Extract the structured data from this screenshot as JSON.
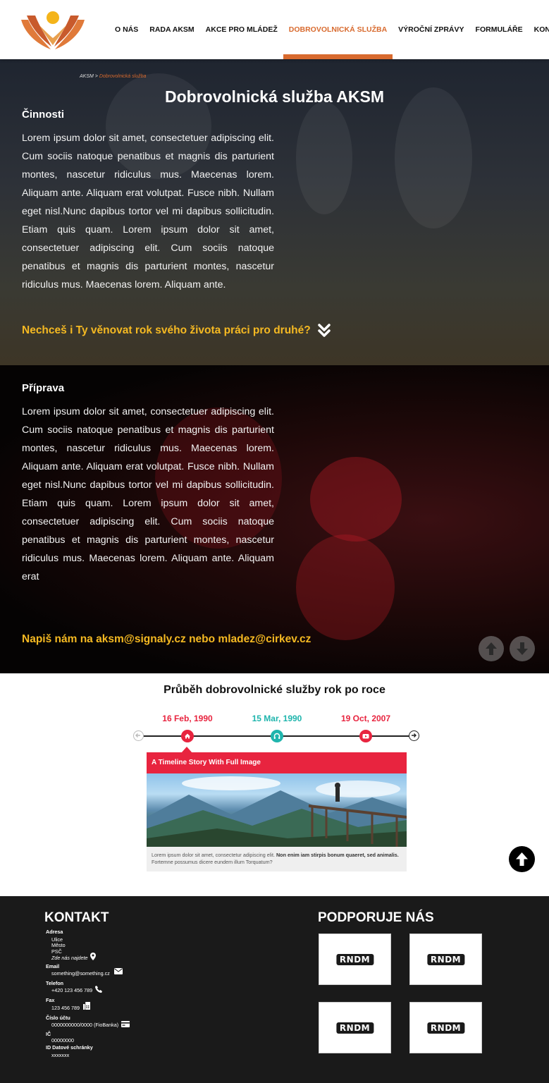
{
  "nav": {
    "items": [
      {
        "label": "O NÁS"
      },
      {
        "label": "RADA AKSM"
      },
      {
        "label": "AKCE PRO MLÁDEŽ"
      },
      {
        "label": "DOBROVOLNICKÁ SLUŽBA",
        "active": true
      },
      {
        "label": "VÝROČNÍ ZPRÁVY"
      },
      {
        "label": "FORMULÁŘE"
      },
      {
        "label": "KONTAKTY"
      }
    ]
  },
  "breadcrumb": {
    "root": "AKSM",
    "separator": ">",
    "current": "Dobrovolnická služba"
  },
  "page_title": "Dobrovolnická služba AKSM",
  "sections": {
    "cinnosti": {
      "heading": "Činnosti",
      "text": "Lorem ipsum dolor sit amet, consectetuer adipiscing elit. Cum sociis natoque penatibus et magnis dis parturient montes, nascetur ridiculus mus. Maecenas lorem. Aliquam ante. Aliquam erat volutpat. Fusce nibh. Nullam eget nisl.Nunc dapibus tortor vel mi dapibus sollicitudin. Etiam quis quam. Lorem ipsum dolor sit amet, consectetuer adipiscing elit. Cum sociis natoque penatibus et magnis dis parturient montes, nascetur ridiculus mus. Maecenas lorem. Aliquam ante.",
      "cta": "Nechceš i Ty věnovat rok svého života práci pro druhé?"
    },
    "priprava": {
      "heading": "Příprava",
      "text": "Lorem ipsum dolor sit amet, consectetuer adipiscing elit. Cum sociis natoque penatibus et magnis dis parturient montes, nascetur ridiculus mus. Maecenas lorem. Aliquam ante. Aliquam erat volutpat. Fusce nibh. Nullam eget nisl.Nunc dapibus tortor vel mi dapibus sollicitudin. Etiam quis quam. Lorem ipsum dolor sit amet, consectetuer adipiscing elit. Cum sociis natoque penatibus et magnis dis parturient montes, nascetur ridiculus mus. Maecenas lorem. Aliquam ante. Aliquam erat",
      "cta": "Napiš nám na aksm@signaly.cz nebo mladez@cirkev.cz"
    }
  },
  "timeline": {
    "title": "Průběh dobrovolnické služby rok po roce",
    "events": [
      {
        "date": "16 Feb, 1990",
        "color": "#e8243f",
        "icon": "home-icon"
      },
      {
        "date": "15 Mar, 1990",
        "color": "#1fb5ad",
        "icon": "headphones-icon"
      },
      {
        "date": "19 Oct, 2007",
        "color": "#e8243f",
        "icon": "video-icon"
      }
    ],
    "card": {
      "title": "A Timeline Story With Full Image",
      "text_plain": "Lorem ipsum dolor sit amet, consectetur adipiscing elit.",
      "text_bold": "Non enim iam stirpis bonum quaeret, sed animalis.",
      "text_end": "Fortemne possumus dicere eundem illum Torquatum?"
    }
  },
  "footer": {
    "contact_title": "KONTAKT",
    "address_label": "Adresa",
    "address_lines": [
      "Ulice",
      "Město",
      "PSČ"
    ],
    "address_link": "Zde nás najdete",
    "email_label": "Email",
    "email_value": "something@something.cz",
    "phone_label": "Telefon",
    "phone_value": "+420 123 456 789",
    "fax_label": "Fax",
    "fax_value": "123 456 789",
    "account_label": "Číslo účtu",
    "account_value": "0000000000/0000 (FioBanka)",
    "ic_label": "IČ",
    "ic_value": "00000000",
    "datbox_label": "ID Datové schránky",
    "datbox_value": "xxxxxxx",
    "support_title": "PODPORUJE NÁS",
    "sponsors": [
      {
        "label": "RNDM"
      },
      {
        "label": "RNDM"
      },
      {
        "label": "RNDM"
      },
      {
        "label": "RNDM"
      }
    ]
  },
  "colors": {
    "accent": "#d86a2e",
    "cta": "#f5b922",
    "timeline_red": "#e8243f",
    "timeline_teal": "#1fb5ad",
    "footer_bg": "#1a1a1a"
  }
}
